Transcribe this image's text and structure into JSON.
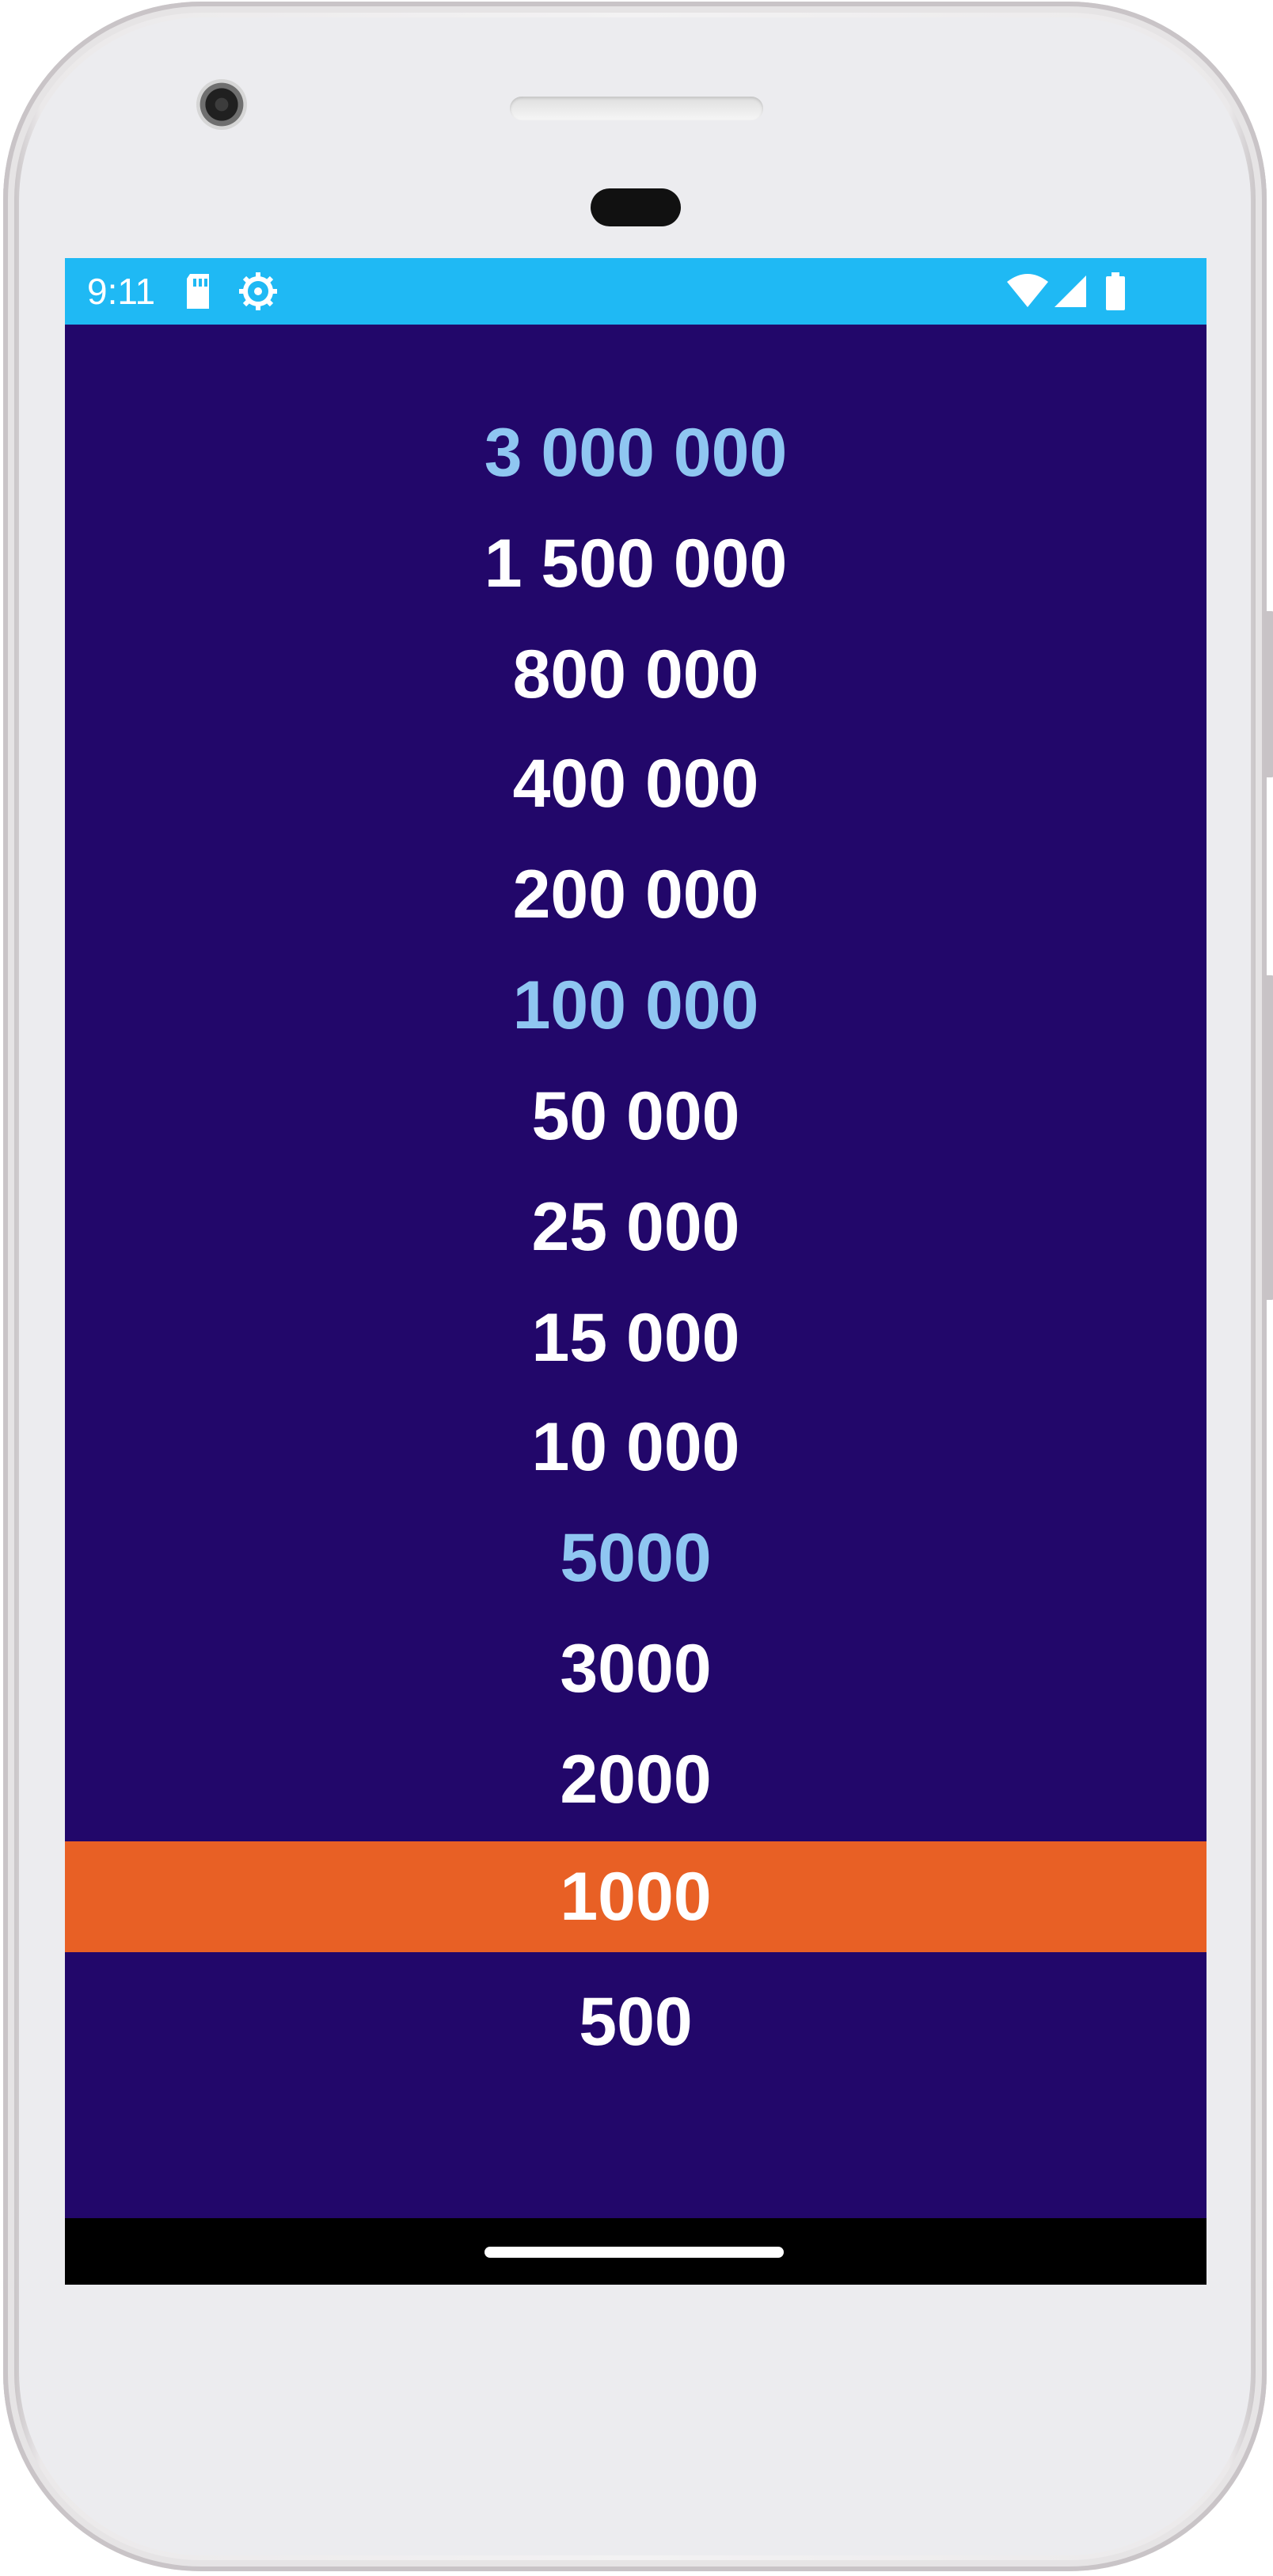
{
  "status_bar": {
    "time": "9:11",
    "background_color": "#1fb9f4",
    "left_icons": [
      "sd-card-icon",
      "settings-gear-icon"
    ],
    "right_icons": [
      "wifi-icon",
      "cell-signal-icon",
      "battery-icon"
    ]
  },
  "theme": {
    "screen_background": "#22076a",
    "milestone_color": "#8fc6f1",
    "current_highlight": "#e86025",
    "default_text": "#ffffff"
  },
  "prize_ladder": [
    {
      "label": "3 000 000",
      "state": "milestone"
    },
    {
      "label": "1 500 000",
      "state": "normal"
    },
    {
      "label": "800 000",
      "state": "normal"
    },
    {
      "label": "400 000",
      "state": "normal"
    },
    {
      "label": "200 000",
      "state": "normal"
    },
    {
      "label": "100 000",
      "state": "milestone"
    },
    {
      "label": "50 000",
      "state": "normal"
    },
    {
      "label": "25 000",
      "state": "normal"
    },
    {
      "label": "15 000",
      "state": "normal"
    },
    {
      "label": "10 000",
      "state": "normal"
    },
    {
      "label": "5000",
      "state": "milestone"
    },
    {
      "label": "3000",
      "state": "normal"
    },
    {
      "label": "2000",
      "state": "normal"
    },
    {
      "label": "1000",
      "state": "current"
    },
    {
      "label": "500",
      "state": "normal"
    }
  ],
  "nav_bar": {
    "handle_icon": "home-handle-icon"
  }
}
